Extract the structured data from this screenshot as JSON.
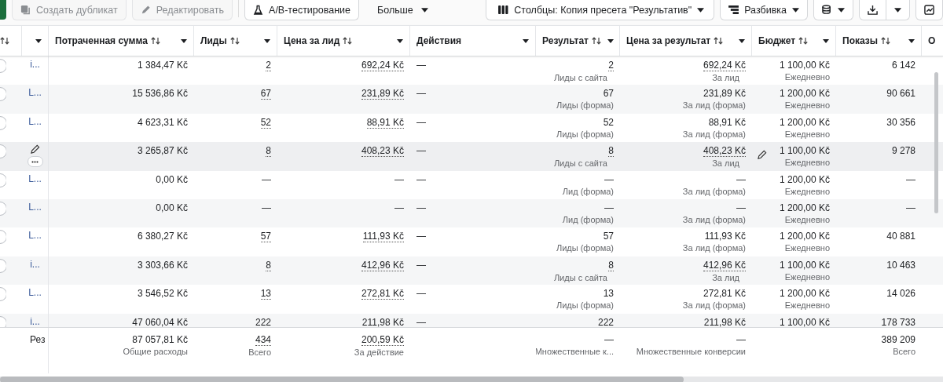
{
  "toolbar": {
    "left": [
      {
        "label": "Создать дубликат",
        "kind": "duplicate",
        "disabled": true
      },
      {
        "label": "Редактировать",
        "kind": "edit",
        "disabled": true
      },
      {
        "label": "A/B-тестирование",
        "kind": "flask",
        "disabled": false
      },
      {
        "label": "Больше",
        "kind": "more",
        "disabled": false
      }
    ],
    "columns_button": "Столбцы: Копия пресета \"Результатив\"",
    "breakdown_button": "Разбивка"
  },
  "table": {
    "columns": [
      {
        "sortable": true,
        "menu": false
      },
      {
        "sortable": false,
        "menu": true
      },
      {
        "label": "Потраченная сумма",
        "sortable": true,
        "menu": true
      },
      {
        "label": "Лиды",
        "sortable": true,
        "menu": true
      },
      {
        "label": "Цена за лид",
        "sortable": true,
        "menu": true
      },
      {
        "label": "Действия",
        "sortable": false,
        "menu": true
      },
      {
        "label": "Результат",
        "sortable": true,
        "menu": true
      },
      {
        "label": "Цена за результат",
        "sortable": true,
        "menu": true
      },
      {
        "label": "Бюджет",
        "sortable": true,
        "menu": true
      },
      {
        "label": "Показы",
        "sortable": true,
        "menu": true
      },
      {
        "label": "О",
        "sortable": false,
        "menu": false
      }
    ],
    "rows": [
      {
        "name": "i...",
        "selected": false,
        "hovered": false,
        "empty": false,
        "dotted": true,
        "spend": "1 384,47 Kč",
        "leads": "2",
        "cpl": "692,24 Kč",
        "actions": "—",
        "result": "2",
        "result_sub": "Лиды с сайта",
        "cpr": "692,24 Kč",
        "cpr_sub": "За лид",
        "budget": "1 100,00 Kč",
        "budget_sub": "Ежедневно",
        "impressions": "6 142"
      },
      {
        "name": "L...",
        "selected": false,
        "hovered": false,
        "empty": false,
        "dotted": false,
        "spend": "15 536,86 Kč",
        "leads": "67",
        "cpl": "231,89 Kč",
        "actions": "—",
        "result": "67",
        "result_sub": "Лиды (форма)",
        "cpr": "231,89 Kč",
        "cpr_sub": "За лид (форма)",
        "budget": "1 200,00 Kč",
        "budget_sub": "Ежедневно",
        "impressions": "90 661"
      },
      {
        "name": "L...",
        "selected": false,
        "hovered": false,
        "empty": false,
        "dotted": false,
        "spend": "4 623,31 Kč",
        "leads": "52",
        "cpl": "88,91 Kč",
        "actions": "—",
        "result": "52",
        "result_sub": "Лиды (форма)",
        "cpr": "88,91 Kč",
        "cpr_sub": "За лид (форма)",
        "budget": "1 200,00 Kč",
        "budget_sub": "Ежедневно",
        "impressions": "30 356"
      },
      {
        "selected": false,
        "hovered": true,
        "empty": false,
        "dotted": true,
        "spend": "3 265,87 Kč",
        "leads": "8",
        "cpl": "408,23 Kč",
        "actions": "—",
        "result": "8",
        "result_sub": "Лиды с сайта",
        "cpr": "408,23 Kč",
        "cpr_sub": "За лид",
        "budget": "1 100,00 Kč",
        "budget_sub": "Ежедневно",
        "impressions": "9 278"
      },
      {
        "name": "L...",
        "selected": false,
        "hovered": false,
        "empty": true,
        "dotted": false,
        "spend": "0,00 Kč",
        "leads": "—",
        "cpl": "—",
        "actions": "—",
        "result": "—",
        "result_sub": "Лид (форма)",
        "cpr": "—",
        "cpr_sub": "За лид (форма)",
        "budget": "1 200,00 Kč",
        "budget_sub": "Ежедневно",
        "impressions": "—"
      },
      {
        "name": "L...",
        "selected": false,
        "hovered": false,
        "empty": true,
        "dotted": false,
        "spend": "0,00 Kč",
        "leads": "—",
        "cpl": "—",
        "actions": "—",
        "result": "—",
        "result_sub": "Лид (форма)",
        "cpr": "—",
        "cpr_sub": "За лид (форма)",
        "budget": "1 200,00 Kč",
        "budget_sub": "Ежедневно",
        "impressions": "—"
      },
      {
        "name": "L...",
        "selected": false,
        "hovered": false,
        "empty": false,
        "dotted": false,
        "spend": "6 380,27 Kč",
        "leads": "57",
        "cpl": "111,93 Kč",
        "actions": "—",
        "result": "57",
        "result_sub": "Лиды (форма)",
        "cpr": "111,93 Kč",
        "cpr_sub": "За лид (форма)",
        "budget": "1 200,00 Kč",
        "budget_sub": "Ежедневно",
        "impressions": "40 881"
      },
      {
        "name": "i...",
        "selected": false,
        "hovered": false,
        "empty": false,
        "dotted": true,
        "spend": "3 303,66 Kč",
        "leads": "8",
        "cpl": "412,96 Kč",
        "actions": "—",
        "result": "8",
        "result_sub": "Лиды с сайта",
        "cpr": "412,96 Kč",
        "cpr_sub": "За лид",
        "budget": "1 100,00 Kč",
        "budget_sub": "Ежедневно",
        "impressions": "10 463"
      },
      {
        "name": "L...",
        "selected": false,
        "hovered": false,
        "empty": false,
        "dotted": false,
        "spend": "3 546,52 Kč",
        "leads": "13",
        "cpl": "272,81 Kč",
        "actions": "—",
        "result": "13",
        "result_sub": "Лиды (форма)",
        "cpr": "272,81 Kč",
        "cpr_sub": "За лид (форма)",
        "budget": "1 200,00 Kč",
        "budget_sub": "Ежедневно",
        "impressions": "14 026"
      },
      {
        "name": "i...",
        "selected": false,
        "hovered": false,
        "empty": false,
        "dotted": true,
        "spend": "47 060,04 Kč",
        "leads": "222",
        "cpl": "211,98 Kč",
        "actions": "—",
        "result": "222",
        "cpr": "211,98 Kč",
        "budget": "1 100,00 Kč",
        "impressions": "178 733"
      }
    ],
    "summary": {
      "label": "Рез",
      "spend": "87 057,81 Kč",
      "spend_sub": "Общие расходы",
      "leads": "434",
      "leads_sub": "Всего",
      "cpl": "200,59 Kč",
      "cpl_sub": "За действие",
      "result": "—",
      "result_sub": "Множественные к...",
      "cpr": "—",
      "cpr_sub": "Множественные конверсии",
      "impressions": "389 209",
      "impressions_sub": "Всего"
    }
  }
}
